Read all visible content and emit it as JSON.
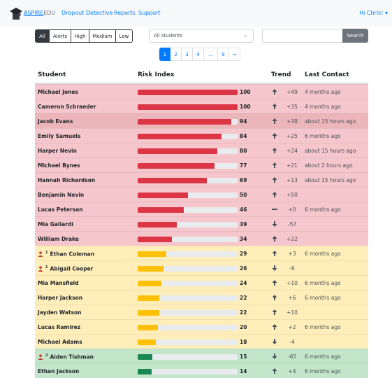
{
  "navbar": {
    "brand_part1": "ASPIRE",
    "brand_part2": "EDU",
    "links": [
      "Dropout Detective",
      "Reports",
      "Support"
    ],
    "user": "Hi Chris! ▾"
  },
  "filters": {
    "buttons": [
      "All",
      "Alerts",
      "High",
      "Medium",
      "Low"
    ],
    "active": "All",
    "select_value": "All students",
    "search_placeholder": "",
    "search_label": "Search"
  },
  "pagination": {
    "pages": [
      "1",
      "2",
      "3",
      "4",
      "...",
      "9",
      "→"
    ],
    "current": "1"
  },
  "table": {
    "headers": {
      "student": "Student",
      "risk": "Risk Index",
      "trend": "Trend",
      "contact": "Last Contact"
    },
    "rows": [
      {
        "name": "Michael Jones",
        "risk": 100,
        "trend_dir": "up",
        "trend": "+49",
        "contact": "4 months ago",
        "level": "danger",
        "alert": ""
      },
      {
        "name": "Cameron Schraeder",
        "risk": 100,
        "trend_dir": "up",
        "trend": "+35",
        "contact": "4 months ago",
        "level": "danger",
        "alert": ""
      },
      {
        "name": "Jacob Evans",
        "risk": 94,
        "trend_dir": "up",
        "trend": "+38",
        "contact": "about 15 hours ago",
        "level": "danger",
        "alert": "",
        "selected": true
      },
      {
        "name": "Emily Samuels",
        "risk": 84,
        "trend_dir": "up",
        "trend": "+25",
        "contact": "6 months ago",
        "level": "danger",
        "alert": ""
      },
      {
        "name": "Harper Nevin",
        "risk": 80,
        "trend_dir": "up",
        "trend": "+24",
        "contact": "about 15 hours ago",
        "level": "danger",
        "alert": ""
      },
      {
        "name": "Michael Bynes",
        "risk": 77,
        "trend_dir": "up",
        "trend": "+21",
        "contact": "about 2 hours ago",
        "level": "danger",
        "alert": ""
      },
      {
        "name": "Hannah Richardson",
        "risk": 69,
        "trend_dir": "up",
        "trend": "+13",
        "contact": "about 15 hours ago",
        "level": "danger",
        "alert": ""
      },
      {
        "name": "Benjamin Nevin",
        "risk": 50,
        "trend_dir": "up",
        "trend": "+50",
        "contact": "",
        "level": "danger",
        "alert": ""
      },
      {
        "name": "Lucas Peterson",
        "risk": 46,
        "trend_dir": "flat",
        "trend": "+0",
        "contact": "6 months ago",
        "level": "danger",
        "alert": ""
      },
      {
        "name": "Mia Galiardi",
        "risk": 39,
        "trend_dir": "down",
        "trend": "-57",
        "contact": "",
        "level": "danger",
        "alert": ""
      },
      {
        "name": "William Drake",
        "risk": 34,
        "trend_dir": "up",
        "trend": "+22",
        "contact": "",
        "level": "danger",
        "alert": ""
      },
      {
        "name": "Ethan Coleman",
        "risk": 29,
        "trend_dir": "up",
        "trend": "+3",
        "contact": "6 months ago",
        "level": "warning",
        "alert": "1"
      },
      {
        "name": "Abigail Cooper",
        "risk": 26,
        "trend_dir": "down",
        "trend": "-6",
        "contact": "",
        "level": "warning",
        "alert": "1"
      },
      {
        "name": "Mia Mansfield",
        "risk": 24,
        "trend_dir": "up",
        "trend": "+10",
        "contact": "6 months ago",
        "level": "warning",
        "alert": ""
      },
      {
        "name": "Harper Jackson",
        "risk": 22,
        "trend_dir": "up",
        "trend": "+6",
        "contact": "6 months ago",
        "level": "warning",
        "alert": ""
      },
      {
        "name": "Jayden Watson",
        "risk": 22,
        "trend_dir": "up",
        "trend": "+10",
        "contact": "",
        "level": "warning",
        "alert": ""
      },
      {
        "name": "Lucas Ramirez",
        "risk": 20,
        "trend_dir": "up",
        "trend": "+2",
        "contact": "6 months ago",
        "level": "warning",
        "alert": ""
      },
      {
        "name": "Michael Adams",
        "risk": 18,
        "trend_dir": "down",
        "trend": "-4",
        "contact": "",
        "level": "warning",
        "alert": ""
      },
      {
        "name": "Aiden Tishman",
        "risk": 15,
        "trend_dir": "down",
        "trend": "-65",
        "contact": "6 months ago",
        "level": "success",
        "alert": "2"
      },
      {
        "name": "Ethan Jackson",
        "risk": 14,
        "trend_dir": "up",
        "trend": "+4",
        "contact": "6 months ago",
        "level": "success",
        "alert": ""
      }
    ]
  },
  "colors": {
    "danger_bar": "#dc3545",
    "warning_bar": "#ffc107",
    "success_bar": "#198754",
    "link": "#007bff",
    "alert_icon": "#c0392b"
  }
}
